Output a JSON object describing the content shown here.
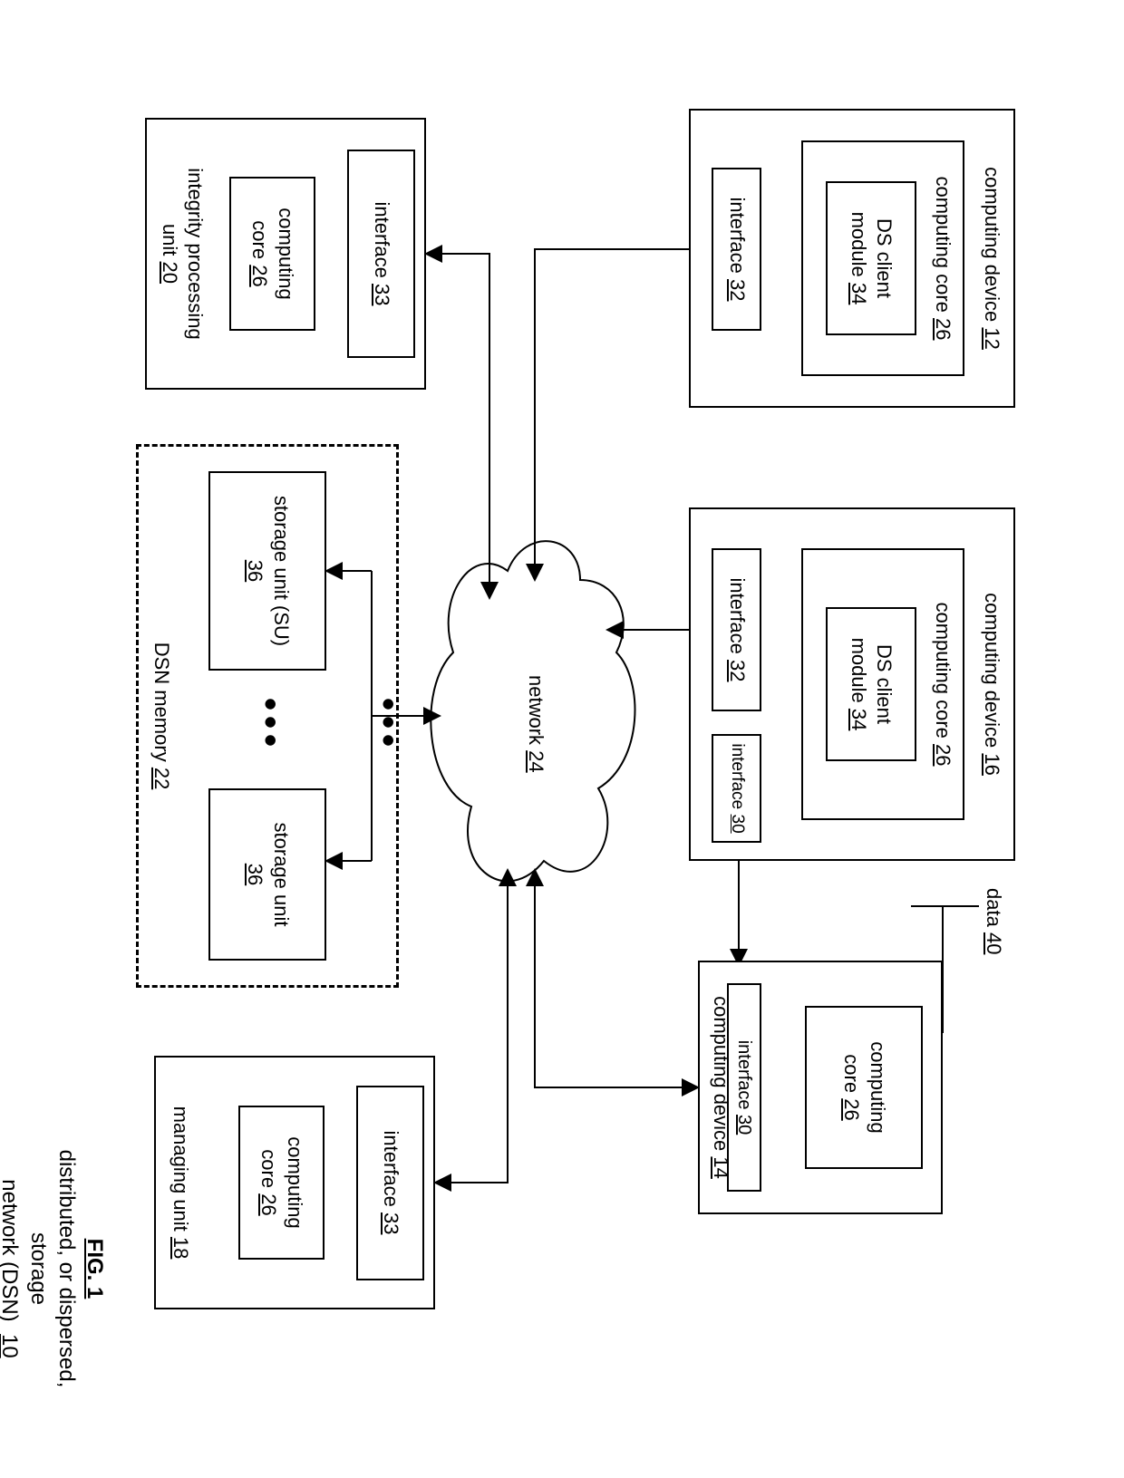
{
  "fig": {
    "title": "FIG. 1",
    "caption1": "distributed, or dispersed, storage",
    "caption2": "network (DSN)",
    "caption_num": "10"
  },
  "data_label": {
    "text": "data",
    "num": "40"
  },
  "cd12": {
    "title": "computing device",
    "num": "12",
    "core": {
      "text": "computing core",
      "num": "26"
    },
    "dsclient": {
      "l1": "DS client",
      "l2": "module",
      "num": "34"
    },
    "iface32": {
      "text": "interface",
      "num": "32"
    }
  },
  "cd16": {
    "title": "computing device",
    "num": "16",
    "core": {
      "text": "computing core",
      "num": "26"
    },
    "dsclient": {
      "l1": "DS client",
      "l2": "module",
      "num": "34"
    },
    "iface32": {
      "text": "interface",
      "num": "32"
    },
    "iface30": {
      "text": "interface",
      "num": "30"
    }
  },
  "cd14": {
    "title": "computing device",
    "num": "14",
    "core": {
      "l1": "computing",
      "l2": "core",
      "num": "26"
    },
    "iface30": {
      "text": "interface",
      "num": "30"
    }
  },
  "network": {
    "text": "network",
    "num": "24"
  },
  "ipu": {
    "title": "integrity processing",
    "title2": "unit",
    "num": "20",
    "iface33": {
      "text": "interface",
      "num": "33"
    },
    "core": {
      "l1": "computing",
      "l2": "core",
      "num": "26"
    }
  },
  "mu": {
    "title": "managing unit",
    "num": "18",
    "iface33": {
      "text": "interface",
      "num": "33"
    },
    "core": {
      "l1": "computing",
      "l2": "core",
      "num": "26"
    }
  },
  "dsn_memory": {
    "text": "DSN memory",
    "num": "22"
  },
  "su1": {
    "l1": "storage unit (SU)",
    "num": "36"
  },
  "su2": {
    "l1": "storage unit",
    "num": "36"
  }
}
